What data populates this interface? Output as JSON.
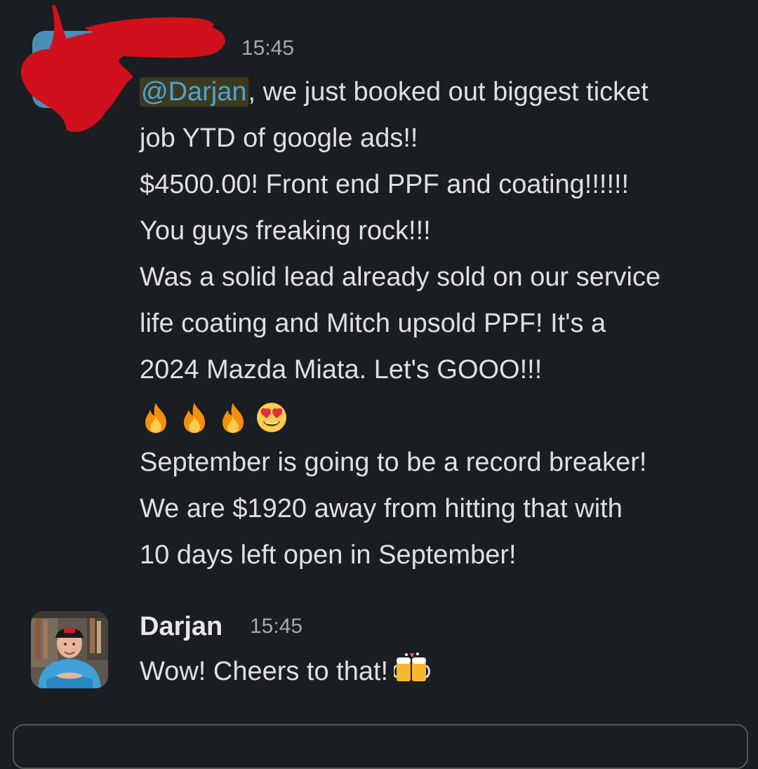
{
  "messages": [
    {
      "author": "",
      "timestamp": "15:45",
      "mention": "@Darjan",
      "lines": [
        ", we just booked out biggest ticket",
        "job YTD of google ads!!",
        "$4500.00! Front end PPF and coating!!!!!!",
        "You guys freaking rock!!!",
        "Was a solid lead already sold on our service",
        "life coating and Mitch upsold PPF! It's a",
        "2024 Mazda Miata. Let's GOOO!!!"
      ],
      "emojis": [
        "fire-emoji",
        "fire-emoji",
        "fire-emoji",
        "heart-eyes-emoji"
      ],
      "lines_after_emoji": [
        "September is going to be a record breaker!",
        "We are $1920 away from hitting that with",
        "10 days left open in September!"
      ]
    },
    {
      "author": "Darjan",
      "timestamp": "15:45",
      "text": "Wow! Cheers to that!",
      "emoji": "beer-mugs-emoji"
    }
  ],
  "colors": {
    "background": "#1a1d21",
    "text": "#e0e0e0",
    "timestamp": "#ababad",
    "mention_text": "#4fa3d6",
    "mention_bg": "#3c3a1e",
    "redaction": "#d0101c"
  }
}
